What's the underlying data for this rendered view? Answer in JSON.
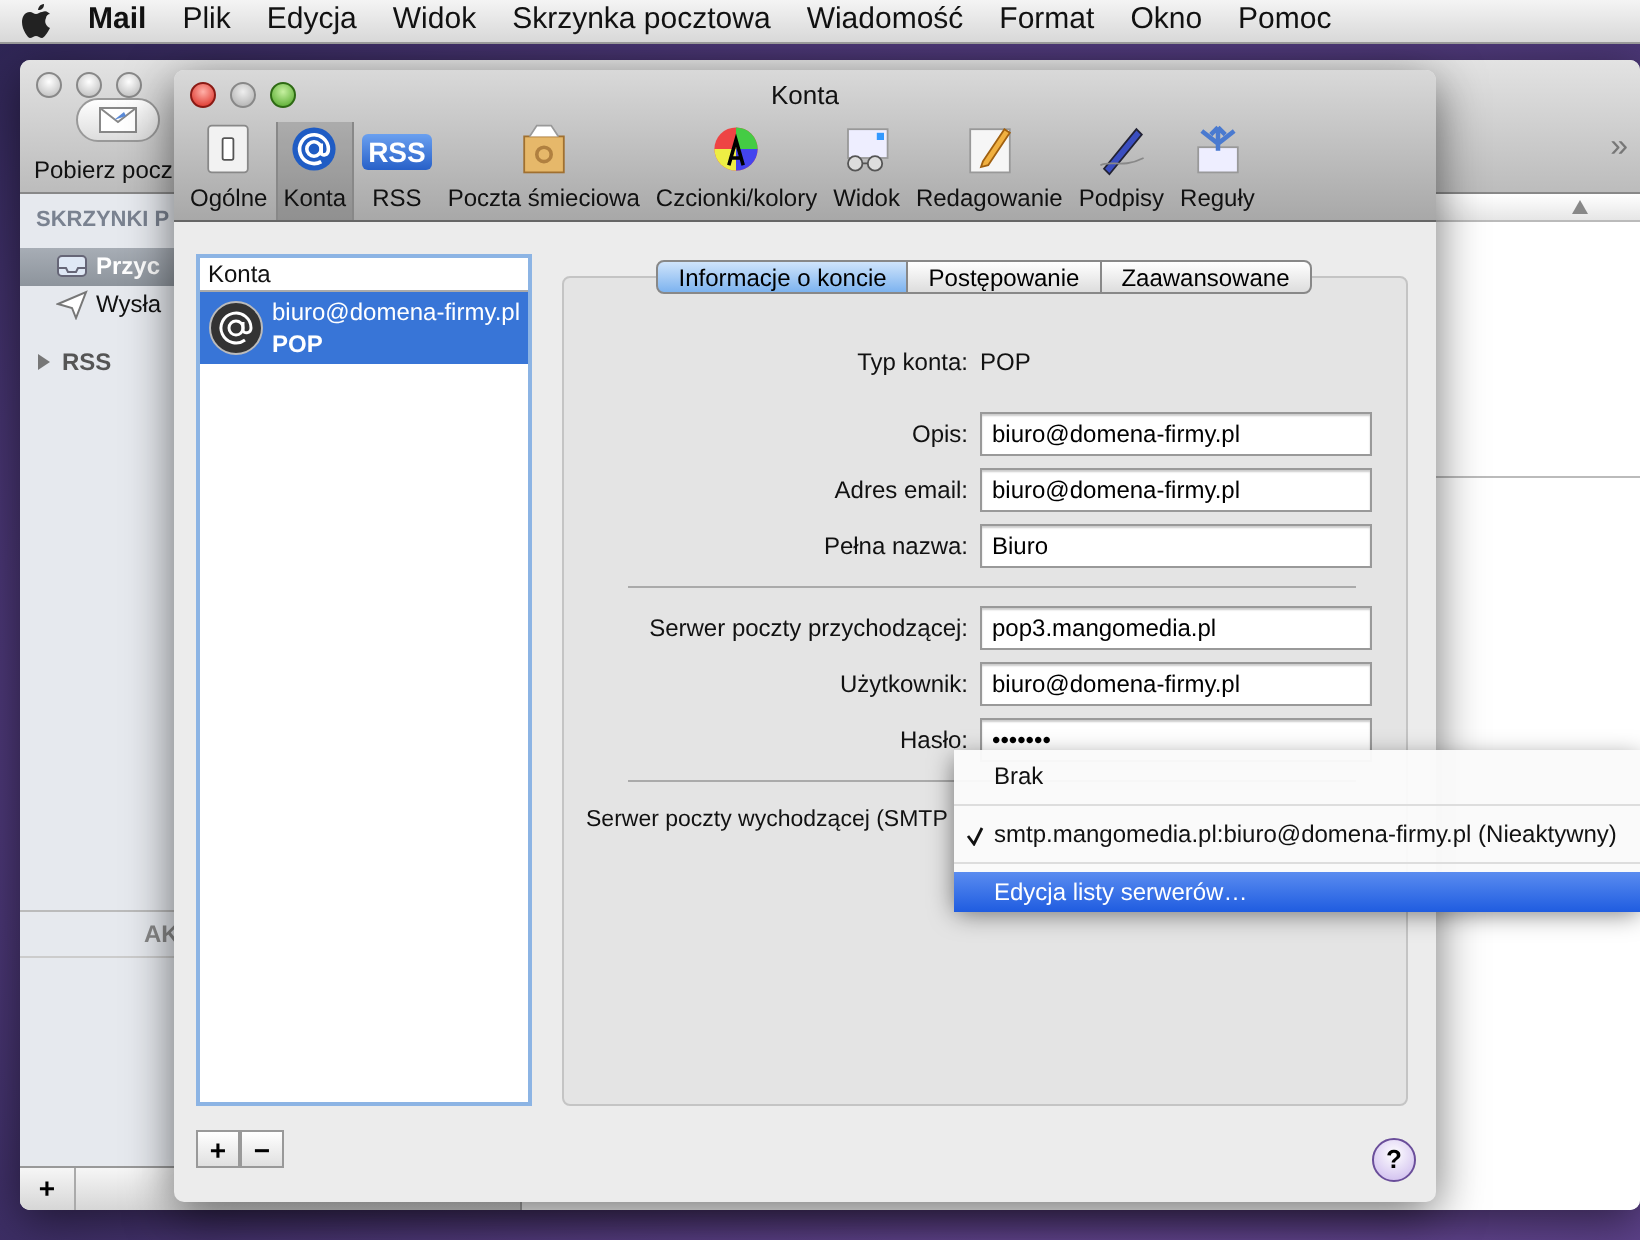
{
  "menu_bar": {
    "app": "Mail",
    "items": [
      "Plik",
      "Edycja",
      "Widok",
      "Skrzynka pocztowa",
      "Wiadomość",
      "Format",
      "Okno",
      "Pomoc"
    ]
  },
  "mail_window": {
    "toolbar_button": "Pobierz pocz",
    "overflow": "»",
    "sidebar_heading": "SKRZYNKI P",
    "mailboxes": [
      {
        "label": "Przyc",
        "kind": "inbox",
        "selected": true
      },
      {
        "label": "Wysła",
        "kind": "sent",
        "selected": false
      }
    ],
    "groups": [
      {
        "label": "RSS",
        "expanded": false
      }
    ],
    "activity_heading": "AK",
    "add_button": "+"
  },
  "dialog": {
    "title": "Konta",
    "toolbar": [
      {
        "label": "Ogólne",
        "kind": "switch",
        "selected": false
      },
      {
        "label": "Konta",
        "kind": "at",
        "selected": true
      },
      {
        "label": "RSS",
        "kind": "rss",
        "icon_text": "RSS",
        "selected": false
      },
      {
        "label": "Poczta śmieciowa",
        "kind": "junk",
        "selected": false
      },
      {
        "label": "Czcionki/kolory",
        "kind": "fonts",
        "selected": false
      },
      {
        "label": "Widok",
        "kind": "view",
        "selected": false
      },
      {
        "label": "Redagowanie",
        "kind": "compose",
        "selected": false
      },
      {
        "label": "Podpisy",
        "kind": "pen",
        "selected": false
      },
      {
        "label": "Reguły",
        "kind": "rules",
        "selected": false
      }
    ],
    "accounts_header": "Konta",
    "accounts": [
      {
        "address": "biuro@domena-firmy.pl",
        "type": "POP",
        "selected": true
      }
    ],
    "add": "+",
    "remove": "−",
    "tabs": [
      {
        "label": "Informacje o koncie",
        "selected": true
      },
      {
        "label": "Postępowanie",
        "selected": false
      },
      {
        "label": "Zaawansowane",
        "selected": false
      }
    ],
    "fields": [
      {
        "kind": "static",
        "label": "Typ konta:",
        "value": "POP"
      },
      {
        "kind": "text",
        "label": "Opis:",
        "value": "biuro@domena-firmy.pl"
      },
      {
        "kind": "text",
        "label": "Adres email:",
        "value": "biuro@domena-firmy.pl"
      },
      {
        "kind": "text",
        "label": "Pełna nazwa:",
        "value": "Biuro"
      },
      {
        "kind": "divider"
      },
      {
        "kind": "text",
        "label": "Serwer poczty przychodzącej:",
        "value": "pop3.mangomedia.pl"
      },
      {
        "kind": "text",
        "label": "Użytkownik:",
        "value": "biuro@domena-firmy.pl"
      },
      {
        "kind": "text",
        "label": "Hasło:",
        "value": "•••••••"
      },
      {
        "kind": "divider"
      },
      {
        "kind": "popup",
        "label": "Serwer poczty wychodzącej (SMTP"
      }
    ],
    "help": "?"
  },
  "popup_menu": [
    {
      "kind": "item",
      "label": "Brak",
      "checked": false,
      "selected": false
    },
    {
      "kind": "separator"
    },
    {
      "kind": "item",
      "label": "smtp.mangomedia.pl:biuro@domena-firmy.pl (Nieaktywny)",
      "checked": true,
      "selected": false
    },
    {
      "kind": "separator"
    },
    {
      "kind": "item",
      "label": "Edycja listy serwerów…",
      "checked": false,
      "selected": true
    }
  ]
}
